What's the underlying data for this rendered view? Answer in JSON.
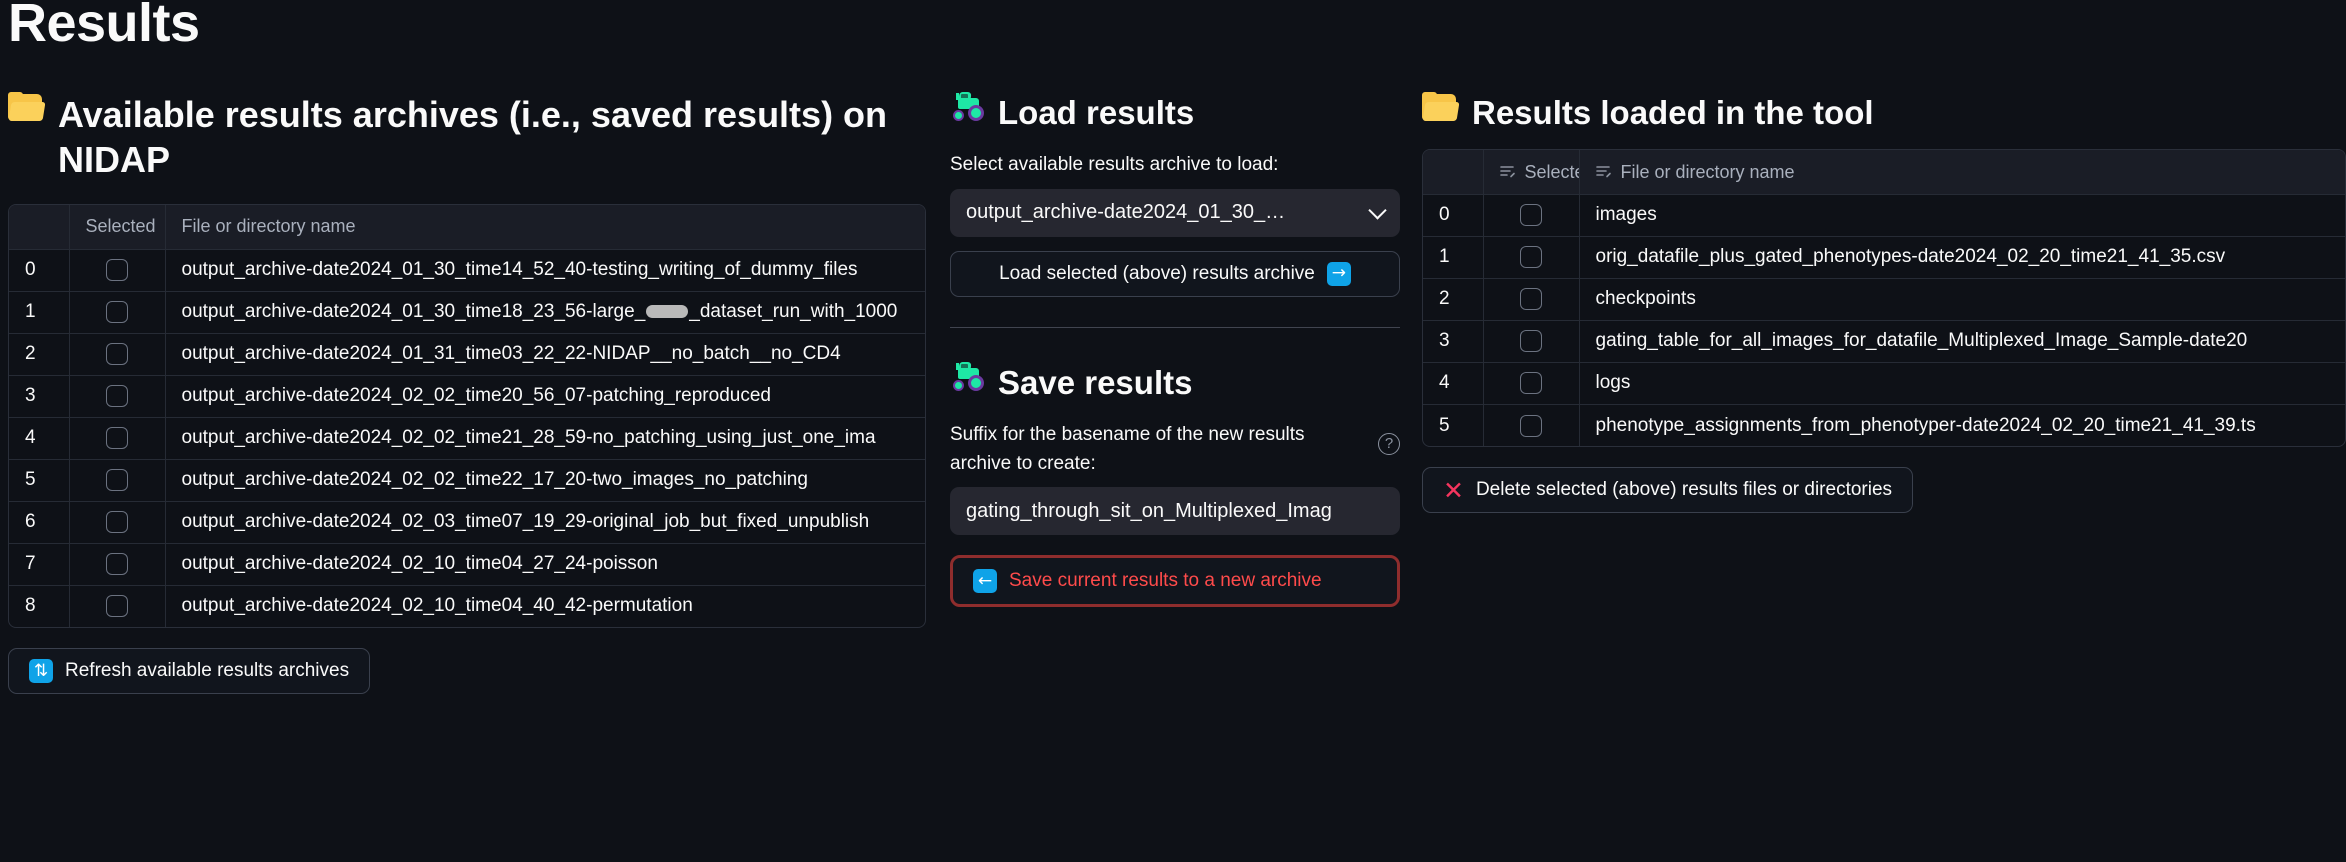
{
  "page": {
    "title": "Results"
  },
  "left": {
    "heading": "Available results archives (i.e., saved results) on NIDAP",
    "heading_icon": "open-folder-icon",
    "table": {
      "columns": [
        "",
        "Selected",
        "File or directory name"
      ],
      "rows": [
        {
          "index": "0",
          "name": "output_archive-date2024_01_30_time14_52_40-testing_writing_of_dummy_files",
          "redacted": false
        },
        {
          "index": "1",
          "name_before": "output_archive-date2024_01_30_time18_23_56-large_",
          "name_after": "_dataset_run_with_1000",
          "redacted": true
        },
        {
          "index": "2",
          "name": "output_archive-date2024_01_31_time03_22_22-NIDAP__no_batch__no_CD4",
          "redacted": false
        },
        {
          "index": "3",
          "name": "output_archive-date2024_02_02_time20_56_07-patching_reproduced",
          "redacted": false
        },
        {
          "index": "4",
          "name": "output_archive-date2024_02_02_time21_28_59-no_patching_using_just_one_ima",
          "redacted": false
        },
        {
          "index": "5",
          "name": "output_archive-date2024_02_02_time22_17_20-two_images_no_patching",
          "redacted": false
        },
        {
          "index": "6",
          "name": "output_archive-date2024_02_03_time07_19_29-original_job_but_fixed_unpublish",
          "redacted": false
        },
        {
          "index": "7",
          "name": "output_archive-date2024_02_10_time04_27_24-poisson",
          "redacted": false
        },
        {
          "index": "8",
          "name": "output_archive-date2024_02_10_time04_40_42-permutation",
          "redacted": false
        }
      ]
    },
    "refresh_button": {
      "label": "Refresh available results archives",
      "icon": "refresh-icon",
      "glyph": "⇅"
    }
  },
  "middle": {
    "load": {
      "heading": "Load results",
      "heading_icon": "tractor-icon",
      "select_label": "Select available results archive to load:",
      "select_value": "output_archive-date2024_01_30_…",
      "load_button": {
        "label": "Load selected (above) results archive",
        "icon": "arrow-right-icon",
        "glyph": "→"
      }
    },
    "save": {
      "heading": "Save results",
      "heading_icon": "tractor-icon",
      "suffix_label": "Suffix for the basename of the new results archive to create:",
      "help_icon": "help-icon",
      "help_glyph": "?",
      "suffix_value": "gating_through_sit_on_Multiplexed_Imag",
      "save_button": {
        "label": "Save current results to a new archive",
        "icon": "arrow-left-icon",
        "glyph": "←"
      }
    }
  },
  "right": {
    "heading": "Results loaded in the tool",
    "heading_icon": "closed-folder-icon",
    "table": {
      "columns": [
        "",
        "Selected",
        "File or directory name"
      ],
      "rows": [
        {
          "index": "0",
          "name": "images"
        },
        {
          "index": "1",
          "name": "orig_datafile_plus_gated_phenotypes-date2024_02_20_time21_41_35.csv"
        },
        {
          "index": "2",
          "name": "checkpoints"
        },
        {
          "index": "3",
          "name": "gating_table_for_all_images_for_datafile_Multiplexed_Image_Sample-date20"
        },
        {
          "index": "4",
          "name": "logs"
        },
        {
          "index": "5",
          "name": "phenotype_assignments_from_phenotyper-date2024_02_20_time21_41_39.ts"
        }
      ]
    },
    "delete_button": {
      "label": "Delete selected (above) results files or directories",
      "icon": "x-mark-icon",
      "glyph": "✕"
    }
  },
  "colors": {
    "background": "#0e1117",
    "text": "#fafafa",
    "muted": "#a9b0bd",
    "accent_blue": "#0fa3e8",
    "danger_red": "#ff4b4b",
    "danger_border": "#8f2d2d",
    "folder_yellow": "#f7c548",
    "tractor_green": "#1ee8a5",
    "delete_x": "#f5355e"
  }
}
